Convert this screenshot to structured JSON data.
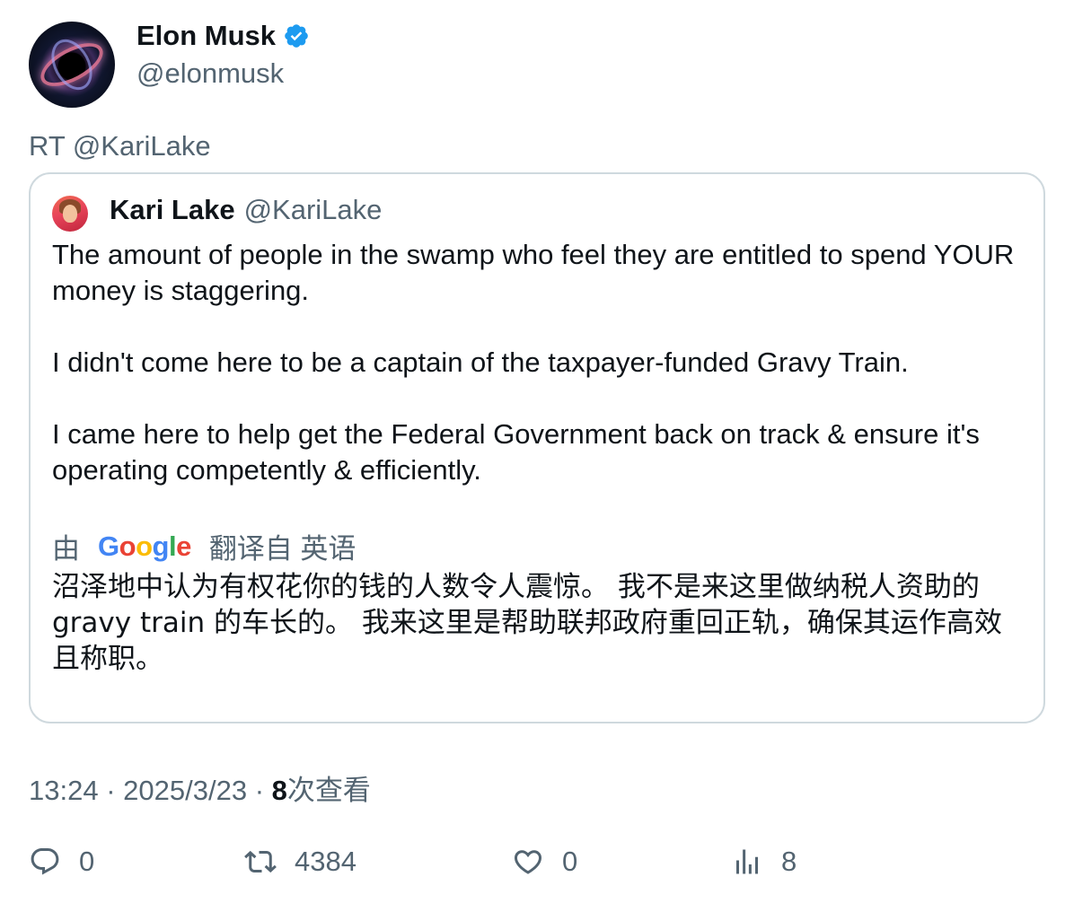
{
  "tweet": {
    "author": {
      "display_name": "Elon Musk",
      "handle": "@elonmusk",
      "verified": true
    },
    "retweet_label": "RT @KariLake",
    "quoted": {
      "display_name": "Kari Lake",
      "handle": "@KariLake",
      "paragraphs": [
        "The amount of people in the swamp who feel they are entitled to spend YOUR money is staggering.",
        "I didn't come here to be a captain of the taxpayer-funded Gravy Train.",
        "I came here to help get the Federal Government back on track & ensure it's operating competently & efficiently."
      ],
      "translation": {
        "prefix": "由",
        "provider": "Google",
        "suffix": "翻译自 英语",
        "text": "沼泽地中认为有权花你的钱的人数令人震惊。 我不是来这里做纳税人资助的 gravy train 的车长的。 我来这里是帮助联邦政府重回正轨，确保其运作高效且称职。"
      }
    },
    "meta": {
      "time": "13:24",
      "separator": "·",
      "date": "2025/3/23",
      "views_count": "8",
      "views_label": "次查看"
    },
    "actions": {
      "replies": "0",
      "retweets": "4384",
      "likes": "0",
      "views": "8"
    }
  },
  "colors": {
    "text_primary": "#0f1419",
    "text_secondary": "#536471",
    "border": "#cfd9de",
    "verified_blue": "#1d9bf0"
  },
  "icons": [
    "verified-badge-icon",
    "reply-icon",
    "retweet-icon",
    "like-icon",
    "views-icon"
  ]
}
